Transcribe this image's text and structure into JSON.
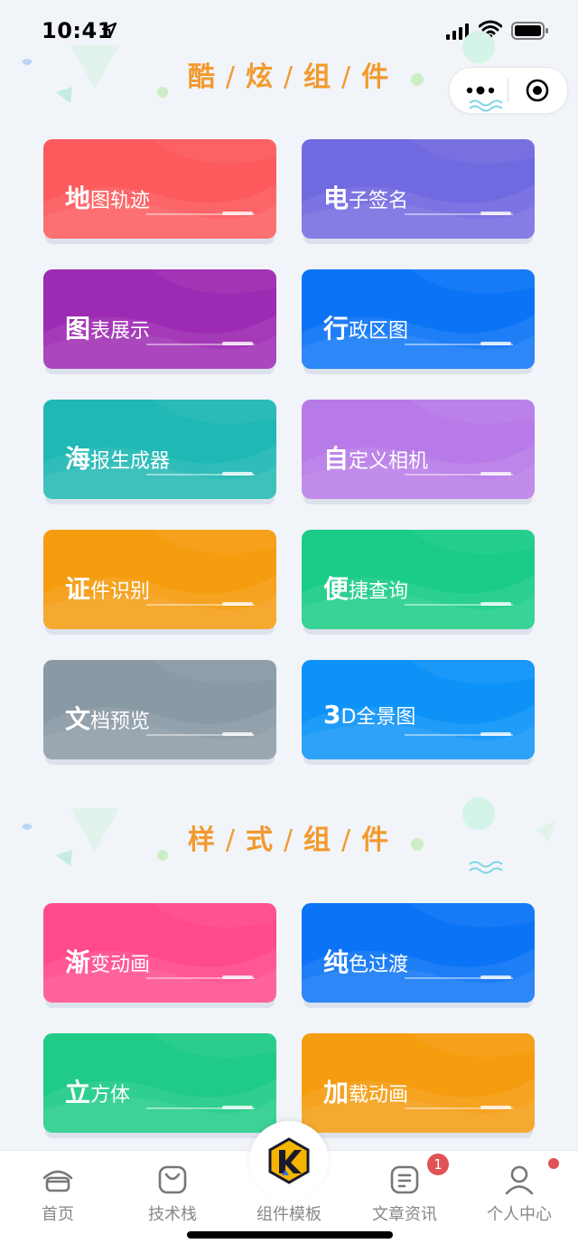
{
  "status": {
    "time": "10:41"
  },
  "sections": [
    {
      "title": [
        "酷",
        "炫",
        "组",
        "件"
      ]
    },
    {
      "title": [
        "样",
        "式",
        "组",
        "件"
      ]
    }
  ],
  "cards": [
    {
      "big": "地",
      "rest": "图轨迹",
      "color": "#fc5a5c"
    },
    {
      "big": "电",
      "rest": "子签名",
      "color": "#7169e0"
    },
    {
      "big": "图",
      "rest": "表展示",
      "color": "#9d2ab2"
    },
    {
      "big": "行",
      "rest": "政区图",
      "color": "#0b73f6"
    },
    {
      "big": "海",
      "rest": "报生成器",
      "color": "#1fb8b4"
    },
    {
      "big": "自",
      "rest": "定义相机",
      "color": "#b87ae8"
    },
    {
      "big": "证",
      "rest": "件识别",
      "color": "#f59c0f"
    },
    {
      "big": "便",
      "rest": "捷查询",
      "color": "#1acc86"
    },
    {
      "big": "文",
      "rest": "档预览",
      "color": "#8a9aa5"
    },
    {
      "big": "3",
      "rest": "D全景图",
      "color": "#0d93f8"
    },
    {
      "big": "渐",
      "rest": "变动画",
      "color": "#ff4a8c"
    },
    {
      "big": "纯",
      "rest": "色过渡",
      "color": "#0b73f6"
    },
    {
      "big": "立",
      "rest": "方体",
      "color": "#1fcb86"
    },
    {
      "big": "加",
      "rest": "载动画",
      "color": "#f59c0f"
    }
  ],
  "tabbar": {
    "items": [
      {
        "label": "首页",
        "icon": "home-icon"
      },
      {
        "label": "技术栈",
        "icon": "bag-icon"
      },
      {
        "label": "组件模板",
        "icon": "logo-icon"
      },
      {
        "label": "文章资讯",
        "icon": "document-icon"
      },
      {
        "label": "个人中心",
        "icon": "user-icon"
      }
    ],
    "badge": "1"
  }
}
